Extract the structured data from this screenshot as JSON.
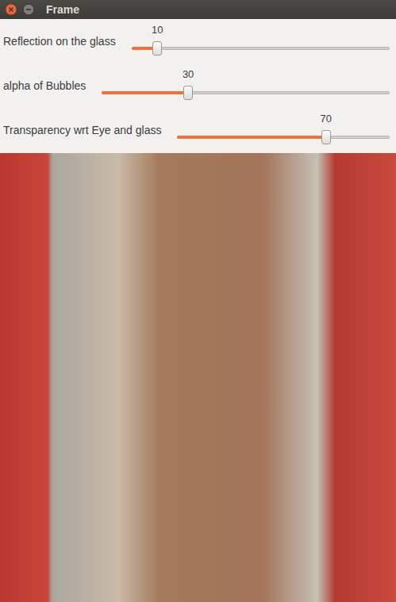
{
  "window": {
    "title": "Frame"
  },
  "sliders": [
    {
      "label": "Reflection on the glass",
      "value": "10",
      "level": 0.1
    },
    {
      "label": "alpha of Bubbles",
      "value": "30",
      "level": 0.3
    },
    {
      "label": "Transparency wrt Eye and glass",
      "value": "70",
      "level": 0.7
    }
  ]
}
